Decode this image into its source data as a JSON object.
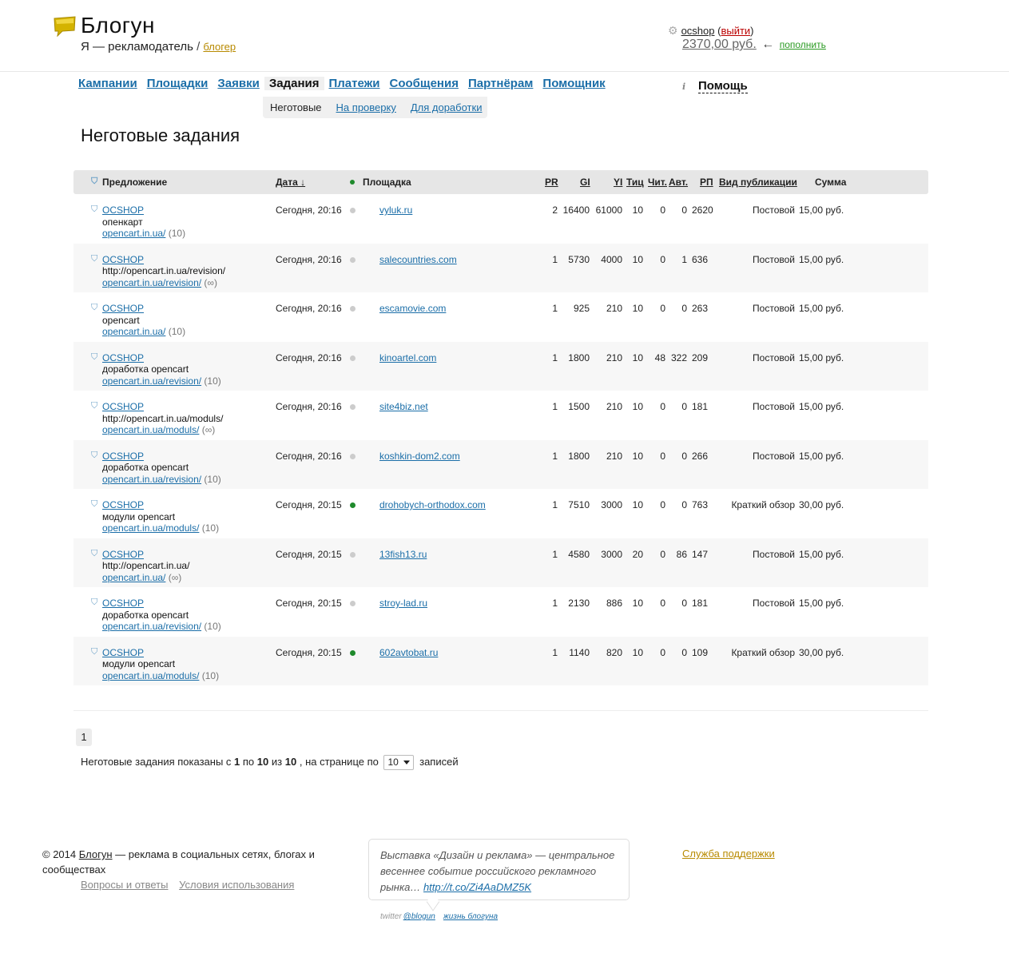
{
  "header": {
    "brand": "Блогун",
    "role_prefix": "Я — рекламодатель",
    "role_sep": "/",
    "role_link": "блогер",
    "username": "ocshop",
    "logout": "выйти",
    "balance": "2370,00 руб.",
    "arrow": "←",
    "topup": "пополнить"
  },
  "nav": {
    "items": [
      "Кампании",
      "Площадки",
      "Заявки",
      "Задания",
      "Платежи",
      "Сообщения",
      "Партнёрам",
      "Помощник"
    ],
    "sub_active": "Неготовые",
    "sub_items": [
      "На проверку",
      "Для доработки"
    ],
    "help_icon": "i",
    "help": "Помощь"
  },
  "page_title": "Неготовые задания",
  "table": {
    "headers": {
      "offer": "Предложение",
      "date": "Дата ↓",
      "site": "Площадка",
      "pr": "PR",
      "gi": "GI",
      "yi": "YI",
      "tic": "Тиц",
      "chit": "Чит.",
      "avt": "Авт.",
      "rp": "РП",
      "vid": "Вид публикации",
      "sum": "Сумма"
    },
    "rows": [
      {
        "offer": "OCSHOP",
        "desc": "опенкарт",
        "url": "opencart.in.ua/",
        "count": "(10)",
        "date": "Сегодня, 20:16",
        "dot": "grey",
        "site": "vyluk.ru",
        "pr": "2",
        "gi": "16400",
        "yi": "61000",
        "tic": "10",
        "chit": "0",
        "avt": "0",
        "rp": "2620",
        "vid": "Постовой",
        "sum": "15,00 руб."
      },
      {
        "offer": "OCSHOP",
        "desc": "http://opencart.in.ua/revision/",
        "url": "opencart.in.ua/revision/",
        "count": "(∞)",
        "date": "Сегодня, 20:16",
        "dot": "grey",
        "site": "salecountries.com",
        "pr": "1",
        "gi": "5730",
        "yi": "4000",
        "tic": "10",
        "chit": "0",
        "avt": "1",
        "rp": "636",
        "vid": "Постовой",
        "sum": "15,00 руб."
      },
      {
        "offer": "OCSHOP",
        "desc": "opencart",
        "url": "opencart.in.ua/",
        "count": "(10)",
        "date": "Сегодня, 20:16",
        "dot": "grey",
        "site": "escamovie.com",
        "pr": "1",
        "gi": "925",
        "yi": "210",
        "tic": "10",
        "chit": "0",
        "avt": "0",
        "rp": "263",
        "vid": "Постовой",
        "sum": "15,00 руб."
      },
      {
        "offer": "OCSHOP",
        "desc": "доработка opencart",
        "url": "opencart.in.ua/revision/",
        "count": "(10)",
        "date": "Сегодня, 20:16",
        "dot": "grey",
        "site": "kinoartel.com",
        "pr": "1",
        "gi": "1800",
        "yi": "210",
        "tic": "10",
        "chit": "48",
        "avt": "322",
        "rp": "209",
        "vid": "Постовой",
        "sum": "15,00 руб."
      },
      {
        "offer": "OCSHOP",
        "desc": "http://opencart.in.ua/moduls/",
        "url": "opencart.in.ua/moduls/",
        "count": "(∞)",
        "date": "Сегодня, 20:16",
        "dot": "grey",
        "site": "site4biz.net",
        "pr": "1",
        "gi": "1500",
        "yi": "210",
        "tic": "10",
        "chit": "0",
        "avt": "0",
        "rp": "181",
        "vid": "Постовой",
        "sum": "15,00 руб."
      },
      {
        "offer": "OCSHOP",
        "desc": "доработка opencart",
        "url": "opencart.in.ua/revision/",
        "count": "(10)",
        "date": "Сегодня, 20:16",
        "dot": "grey",
        "site": "koshkin-dom2.com",
        "pr": "1",
        "gi": "1800",
        "yi": "210",
        "tic": "10",
        "chit": "0",
        "avt": "0",
        "rp": "266",
        "vid": "Постовой",
        "sum": "15,00 руб."
      },
      {
        "offer": "OCSHOP",
        "desc": "модули opencart",
        "url": "opencart.in.ua/moduls/",
        "count": "(10)",
        "date": "Сегодня, 20:15",
        "dot": "green",
        "site": "drohobych-orthodox.com",
        "pr": "1",
        "gi": "7510",
        "yi": "3000",
        "tic": "10",
        "chit": "0",
        "avt": "0",
        "rp": "763",
        "vid": "Краткий обзор",
        "sum": "30,00 руб."
      },
      {
        "offer": "OCSHOP",
        "desc": "http://opencart.in.ua/",
        "url": "opencart.in.ua/",
        "count": "(∞)",
        "date": "Сегодня, 20:15",
        "dot": "grey",
        "site": "13fish13.ru",
        "pr": "1",
        "gi": "4580",
        "yi": "3000",
        "tic": "20",
        "chit": "0",
        "avt": "86",
        "rp": "147",
        "vid": "Постовой",
        "sum": "15,00 руб."
      },
      {
        "offer": "OCSHOP",
        "desc": "доработка opencart",
        "url": "opencart.in.ua/revision/",
        "count": "(10)",
        "date": "Сегодня, 20:15",
        "dot": "grey",
        "site": "stroy-lad.ru",
        "pr": "1",
        "gi": "2130",
        "yi": "886",
        "tic": "10",
        "chit": "0",
        "avt": "0",
        "rp": "181",
        "vid": "Постовой",
        "sum": "15,00 руб."
      },
      {
        "offer": "OCSHOP",
        "desc": "модули opencart",
        "url": "opencart.in.ua/moduls/",
        "count": "(10)",
        "date": "Сегодня, 20:15",
        "dot": "green",
        "site": "602avtobat.ru",
        "pr": "1",
        "gi": "1140",
        "yi": "820",
        "tic": "10",
        "chit": "0",
        "avt": "0",
        "rp": "109",
        "vid": "Краткий обзор",
        "sum": "30,00 руб."
      }
    ]
  },
  "pagination": {
    "page": "1",
    "info_prefix": "Неготовые задания показаны с",
    "from": "1",
    "to_word": "по",
    "to": "10",
    "of_word": "из",
    "total": "10",
    "per_page_word": ", на странице по",
    "per_page": "10",
    "suffix": "записей"
  },
  "footer": {
    "copy_prefix": "© 2014",
    "brand_link": "Блогун",
    "copy_suffix": "— реклама в социальных сетях, блогах и сообществах",
    "faq": "Вопросы и ответы",
    "terms": "Условия использования",
    "tweet_text": "Выставка «Дизайн и реклама» — центральное весеннее событие российского рекламного рынка…",
    "tweet_link": "http://t.co/Zi4AaDMZ5K",
    "twitter_label": "twitter",
    "twitter_handle": "@blogun",
    "life_link": "жизнь блогуна",
    "support": "Служба поддержки"
  },
  "colors": {
    "link": "#1b6ea8",
    "gold_link": "#b88a00",
    "green_dot": "#1f8a2c",
    "header_bg": "#e6e6e6",
    "logo": "#d4b300"
  },
  "icons": [
    "logo-speech-bubble-icon",
    "gear-icon",
    "info-icon",
    "shield-icon",
    "status-dot-icon",
    "select-caret-icon"
  ]
}
